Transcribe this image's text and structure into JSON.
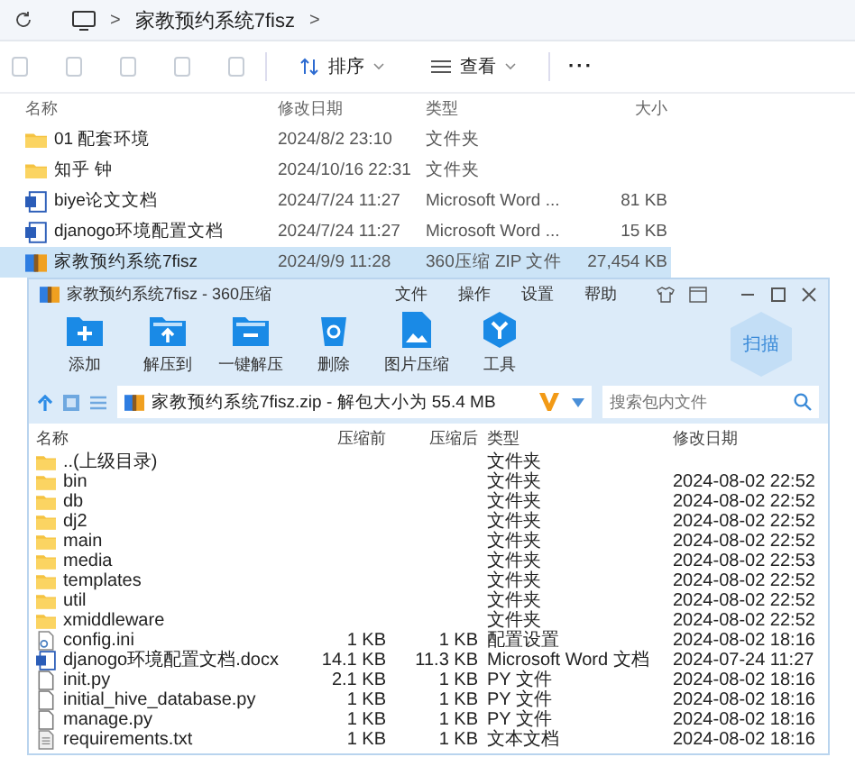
{
  "explorer": {
    "breadcrumb": [
      ">",
      "家教预约系统7fisz",
      ">"
    ],
    "toolbar": [
      {
        "label": "排序"
      },
      {
        "label": "查看"
      }
    ],
    "more": "···",
    "columns": [
      "名称",
      "修改日期",
      "类型",
      "大小"
    ],
    "rows": [
      {
        "kind": "folder",
        "name": "01 配套环境",
        "date": "2024/8/2 23:10",
        "type": "文件夹",
        "size": "",
        "selected": false
      },
      {
        "kind": "folder",
        "name": "知乎 钟",
        "date": "2024/10/16 22:31",
        "type": "文件夹",
        "size": "",
        "selected": false
      },
      {
        "kind": "word",
        "name": "biye论文文档",
        "date": "2024/7/24 11:27",
        "type": "Microsoft Word ...",
        "size": "81 KB",
        "selected": false
      },
      {
        "kind": "word",
        "name": "djanogo环境配置文档",
        "date": "2024/7/24 11:27",
        "type": "Microsoft Word ...",
        "size": "15 KB",
        "selected": false
      },
      {
        "kind": "zip",
        "name": "家教预约系统7fisz",
        "date": "2024/9/9 11:28",
        "type": "360压缩 ZIP 文件",
        "size": "27,454 KB",
        "selected": true
      }
    ]
  },
  "archiver": {
    "title": "家教预约系统7fisz - 360压缩",
    "menu": [
      "文件",
      "操作",
      "设置",
      "帮助"
    ],
    "tools": [
      {
        "kind": "add",
        "label": "添加"
      },
      {
        "kind": "extract",
        "label": "解压到"
      },
      {
        "kind": "oneclick",
        "label": "一键解压"
      },
      {
        "kind": "delete",
        "label": "删除"
      },
      {
        "kind": "image",
        "label": "图片压缩"
      },
      {
        "kind": "tools",
        "label": "工具"
      }
    ],
    "scan": "扫描",
    "path": "家教预约系统7fisz.zip - 解包大小为 55.4 MB",
    "search": {
      "placeholder": "搜索包内文件"
    },
    "columns": [
      "名称",
      "压缩前",
      "压缩后",
      "类型",
      "修改日期"
    ],
    "rows": [
      {
        "kind": "folder",
        "name": "..(上级目录)",
        "before": "",
        "after": "",
        "type": "文件夹",
        "date": ""
      },
      {
        "kind": "folder",
        "name": "bin",
        "before": "",
        "after": "",
        "type": "文件夹",
        "date": "2024-08-02 22:52"
      },
      {
        "kind": "folder",
        "name": "db",
        "before": "",
        "after": "",
        "type": "文件夹",
        "date": "2024-08-02 22:52"
      },
      {
        "kind": "folder",
        "name": "dj2",
        "before": "",
        "after": "",
        "type": "文件夹",
        "date": "2024-08-02 22:52"
      },
      {
        "kind": "folder",
        "name": "main",
        "before": "",
        "after": "",
        "type": "文件夹",
        "date": "2024-08-02 22:52"
      },
      {
        "kind": "folder",
        "name": "media",
        "before": "",
        "after": "",
        "type": "文件夹",
        "date": "2024-08-02 22:53"
      },
      {
        "kind": "folder",
        "name": "templates",
        "before": "",
        "after": "",
        "type": "文件夹",
        "date": "2024-08-02 22:52"
      },
      {
        "kind": "folder",
        "name": "util",
        "before": "",
        "after": "",
        "type": "文件夹",
        "date": "2024-08-02 22:52"
      },
      {
        "kind": "folder",
        "name": "xmiddleware",
        "before": "",
        "after": "",
        "type": "文件夹",
        "date": "2024-08-02 22:52"
      },
      {
        "kind": "config",
        "name": "config.ini",
        "before": "1 KB",
        "after": "1 KB",
        "type": "配置设置",
        "date": "2024-08-02 18:16"
      },
      {
        "kind": "word",
        "name": "djanogo环境配置文档.docx",
        "before": "14.1 KB",
        "after": "11.3 KB",
        "type": "Microsoft Word 文档",
        "date": "2024-07-24 11:27"
      },
      {
        "kind": "file",
        "name": "init.py",
        "before": "2.1 KB",
        "after": "1 KB",
        "type": "PY 文件",
        "date": "2024-08-02 18:16"
      },
      {
        "kind": "file",
        "name": "initial_hive_database.py",
        "before": "1 KB",
        "after": "1 KB",
        "type": "PY 文件",
        "date": "2024-08-02 18:16"
      },
      {
        "kind": "file",
        "name": "manage.py",
        "before": "1 KB",
        "after": "1 KB",
        "type": "PY 文件",
        "date": "2024-08-02 18:16"
      },
      {
        "kind": "text",
        "name": "requirements.txt",
        "before": "1 KB",
        "after": "1 KB",
        "type": "文本文档",
        "date": "2024-08-02 18:16"
      }
    ]
  }
}
